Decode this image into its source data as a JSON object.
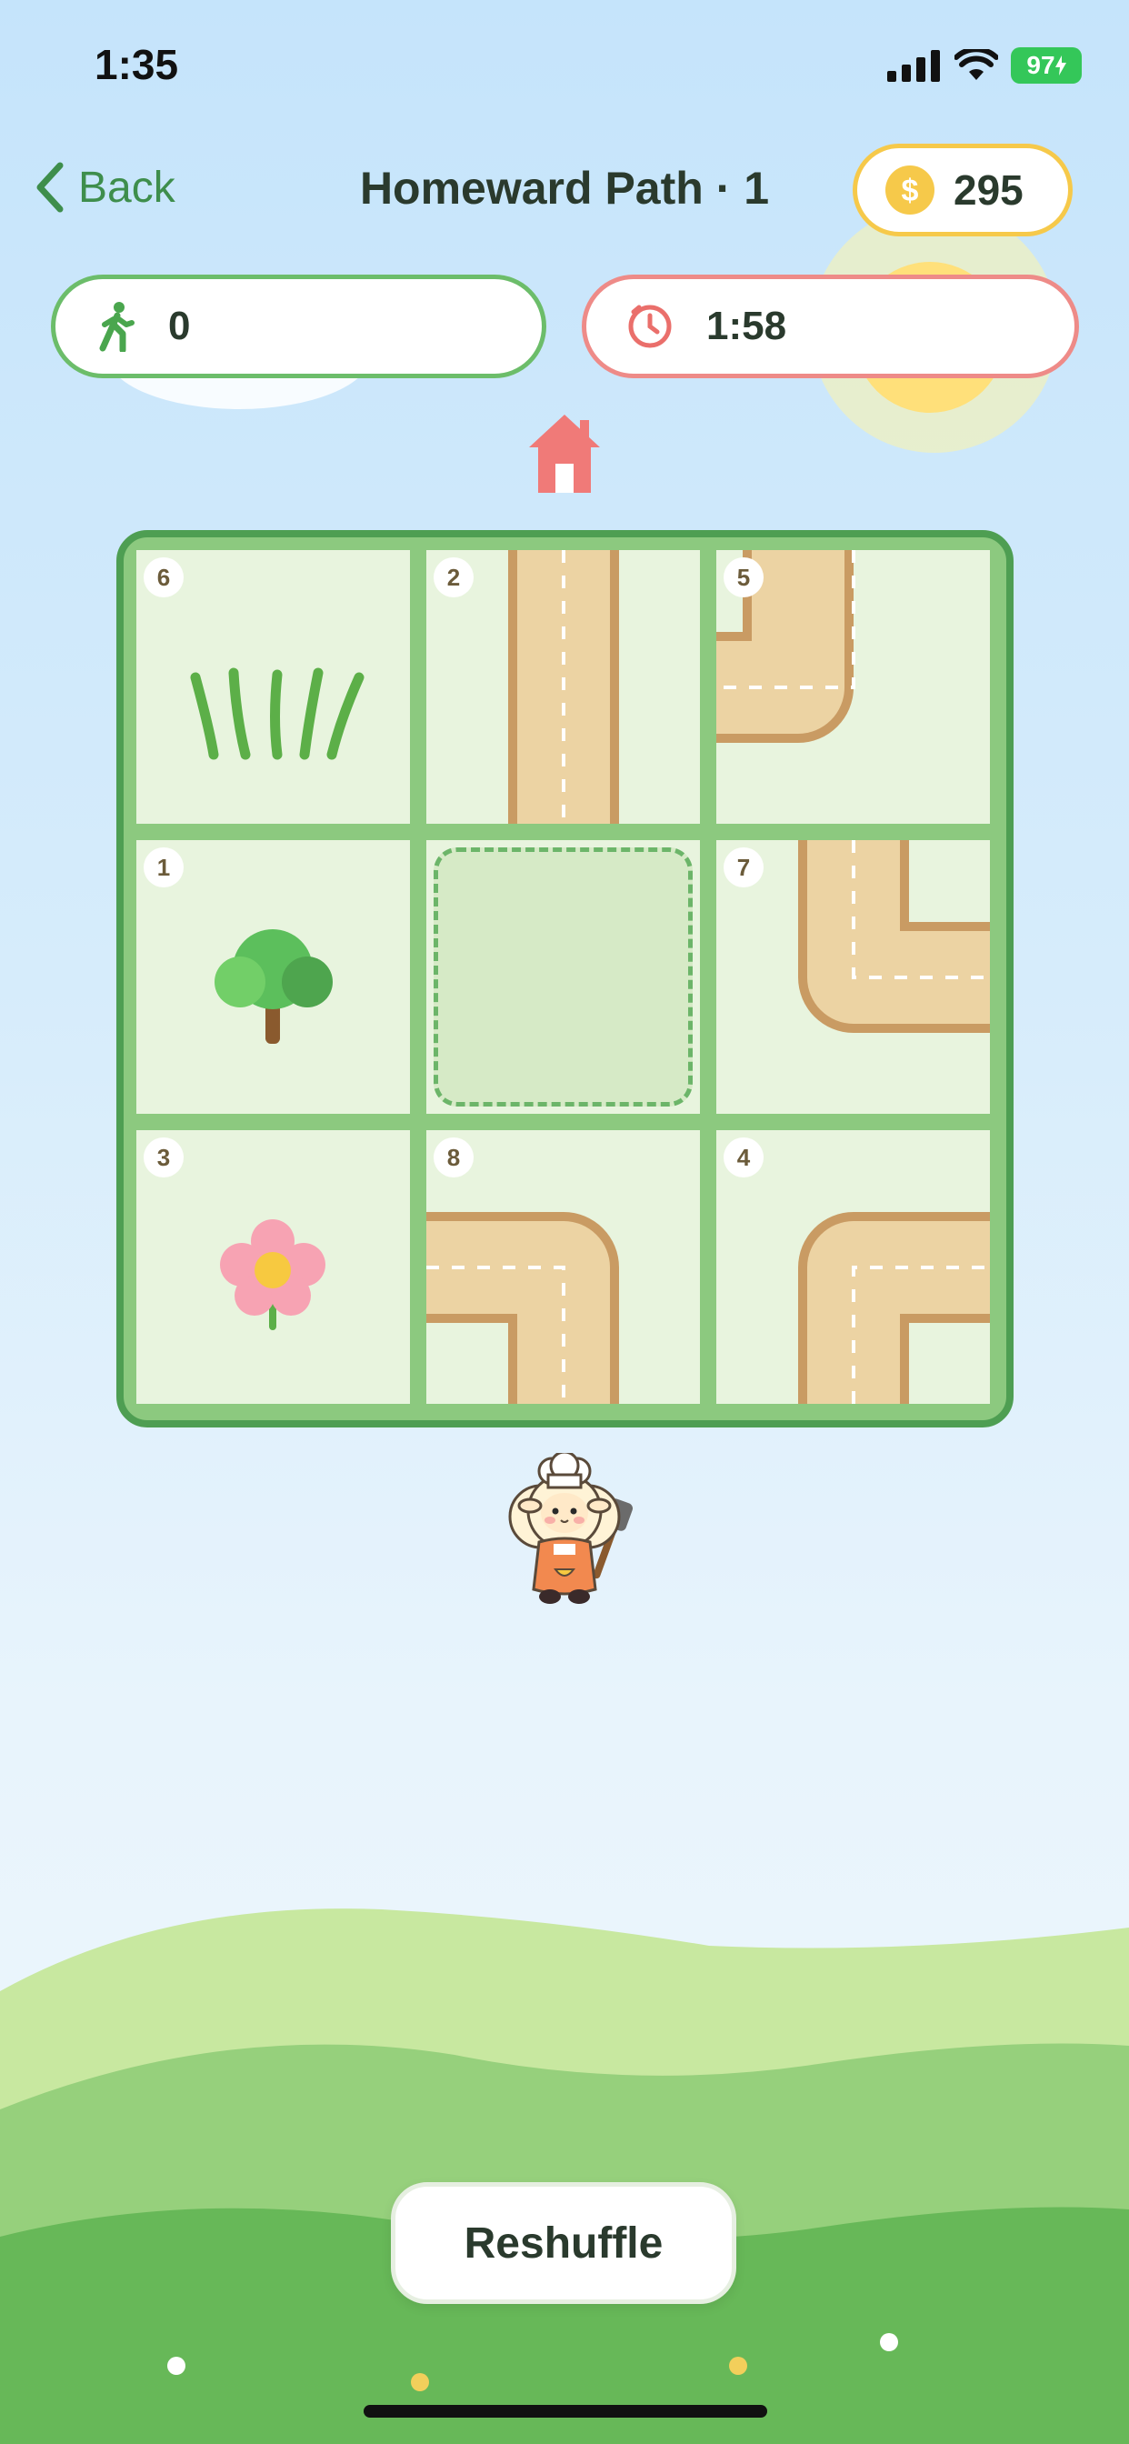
{
  "status_bar": {
    "time": "1:35",
    "battery": "97"
  },
  "header": {
    "back_label": "Back",
    "title": "Homeward Path · 1",
    "coins": "295"
  },
  "stats": {
    "moves": "0",
    "timer": "1:58"
  },
  "board": {
    "rows": 3,
    "cols": 3,
    "tiles": [
      {
        "number": "6",
        "content": "grass"
      },
      {
        "number": "2",
        "content": "road-vertical"
      },
      {
        "number": "5",
        "content": "road-corner-top-left"
      },
      {
        "number": "1",
        "content": "tree"
      },
      {
        "number": "",
        "content": "empty-slot"
      },
      {
        "number": "7",
        "content": "road-corner-top-right"
      },
      {
        "number": "3",
        "content": "flower"
      },
      {
        "number": "8",
        "content": "road-corner-left-bottom"
      },
      {
        "number": "4",
        "content": "road-corner-bottom-right"
      }
    ]
  },
  "reshuffle_label": "Reshuffle",
  "colors": {
    "board_border": "#4e9e52",
    "road": "#ecd3a3",
    "road_edge": "#c99b63",
    "moves_accent": "#6cbd6a",
    "timer_accent": "#ee8b88",
    "coin": "#f6c94a"
  }
}
